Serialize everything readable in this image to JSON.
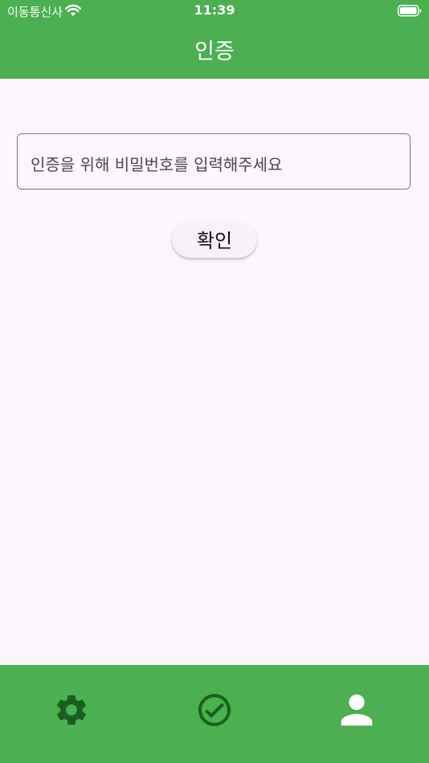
{
  "status_bar": {
    "carrier": "이동통신사",
    "time": "11:39"
  },
  "header": {
    "title": "인증"
  },
  "form": {
    "password_placeholder": "인증을 위해 비밀번호를 입력해주세요",
    "confirm_label": "확인"
  },
  "bottom_nav": {
    "items": [
      {
        "icon": "gear-icon",
        "selected": false
      },
      {
        "icon": "check-circle-icon",
        "selected": false
      },
      {
        "icon": "person-icon",
        "selected": true
      }
    ]
  },
  "colors": {
    "primary": "#4CAF50",
    "background": "#FCF7FE",
    "nav_inactive_icon": "#1B5E20",
    "nav_active_icon": "#FFFFFF"
  }
}
